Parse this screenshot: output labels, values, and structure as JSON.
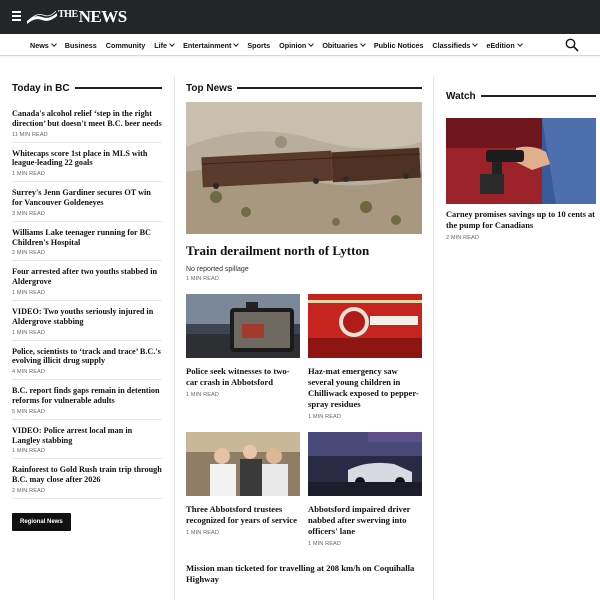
{
  "header": {
    "logo_the": "THE",
    "logo_name": "NEWS"
  },
  "nav": {
    "items": [
      {
        "label": "News",
        "dropdown": true
      },
      {
        "label": "Business",
        "dropdown": false
      },
      {
        "label": "Community",
        "dropdown": false
      },
      {
        "label": "Life",
        "dropdown": true
      },
      {
        "label": "Entertainment",
        "dropdown": true
      },
      {
        "label": "Sports",
        "dropdown": false
      },
      {
        "label": "Opinion",
        "dropdown": true
      },
      {
        "label": "Obituaries",
        "dropdown": true
      },
      {
        "label": "Public Notices",
        "dropdown": false
      },
      {
        "label": "Classifieds",
        "dropdown": true
      },
      {
        "label": "eEdition",
        "dropdown": true
      }
    ],
    "search_icon": "search-icon"
  },
  "today": {
    "heading": "Today in BC",
    "items": [
      {
        "title": "Canada's alcohol relief ‘step in the right direction’ but doesn't meet B.C. beer needs",
        "meta": "11 MIN READ"
      },
      {
        "title": "Whitecaps score 1st place in MLS with league-leading 22 goals",
        "meta": "1 MIN READ"
      },
      {
        "title": "Surrey's Jenn Gardiner secures OT win for Vancouver Goldeneyes",
        "meta": "3 MIN READ"
      },
      {
        "title": "Williams Lake teenager running for BC Children's Hospital",
        "meta": "2 MIN READ"
      },
      {
        "title": "Four arrested after two youths stabbed in Aldergrove",
        "meta": "1 MIN READ"
      },
      {
        "title": "VIDEO: Two youths seriously injured in Aldergrove stabbing",
        "meta": "1 MIN READ"
      },
      {
        "title": "Police, scientists to ‘track and trace’ B.C.'s evolving illicit drug supply",
        "meta": "4 MIN READ"
      },
      {
        "title": "B.C. report finds gaps remain in detention reforms for vulnerable adults",
        "meta": "5 MIN READ"
      },
      {
        "title": "VIDEO: Police arrest local man in Langley stabbing",
        "meta": "1 MIN READ"
      },
      {
        "title": "Rainforest to Gold Rush train trip through B.C. may close after 2026",
        "meta": "2 MIN READ"
      }
    ],
    "button": "Regional News"
  },
  "top": {
    "heading": "Top News",
    "hero": {
      "title": "Train derailment north of Lytton",
      "subtitle": "No reported spillage",
      "meta": "1 MIN READ"
    },
    "cards": [
      {
        "title": "Police seek witnesses to two-car crash in Abbotsford",
        "meta": "1 MIN READ"
      },
      {
        "title": "Haz-mat emergency saw several young children in Chilliwack exposed to pepper-spray residues",
        "meta": "1 MIN READ"
      },
      {
        "title": "Three Abbotsford trustees recognized for years of service",
        "meta": "1 MIN READ"
      },
      {
        "title": "Abbotsford impaired driver nabbed after swerving into officers' lane",
        "meta": "1 MIN READ"
      }
    ],
    "bottom_story": "Mission man ticketed for travelling at 208 km/h on Coquihalla Highway"
  },
  "watch": {
    "heading": "Watch",
    "story": {
      "title": "Carney promises savings up to 10 cents at the pump for Canadians",
      "meta": "2 MIN READ"
    }
  }
}
